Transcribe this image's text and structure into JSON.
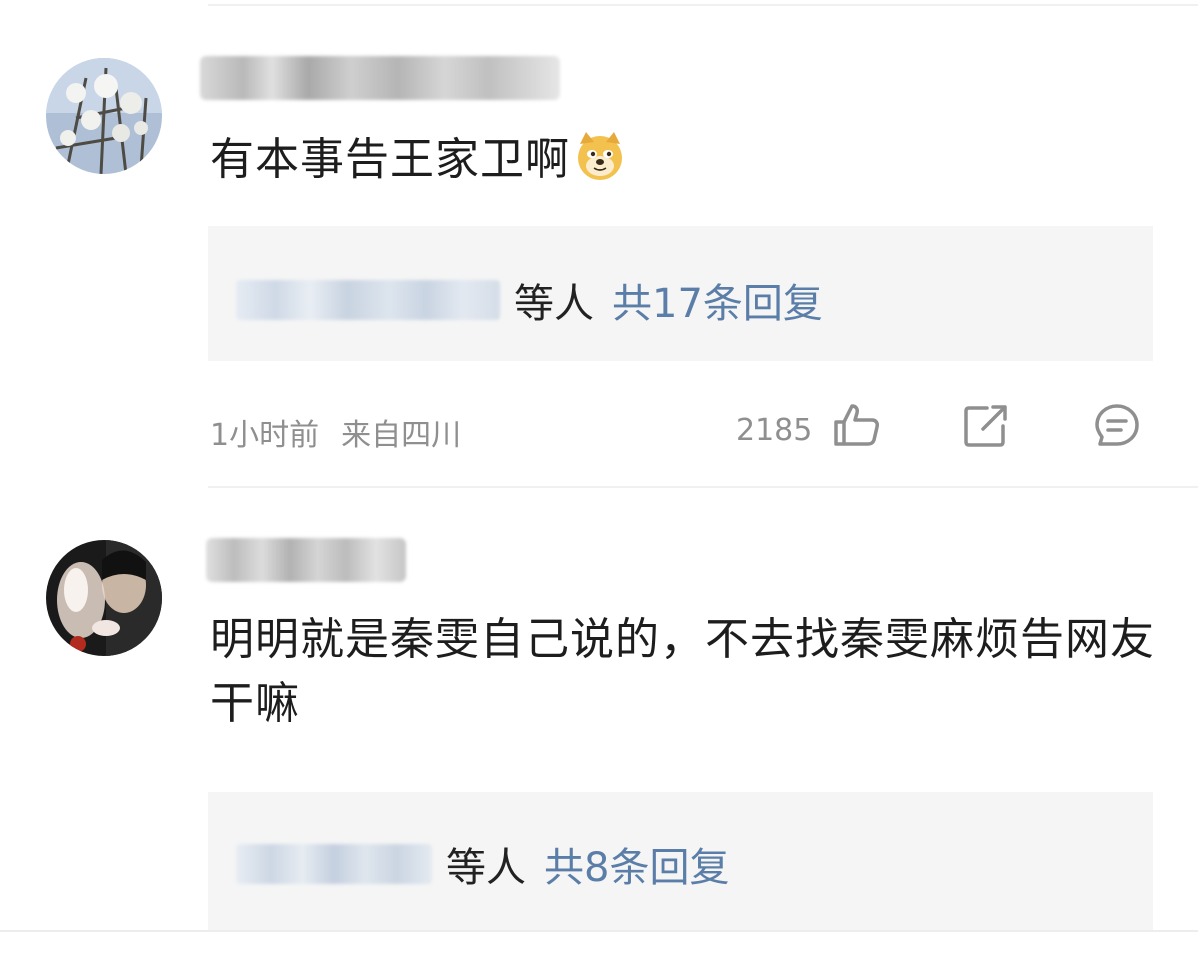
{
  "comments": [
    {
      "text": "有本事告王家卫啊",
      "emoji": "doge-emoji",
      "reply_etc": "等人",
      "reply_count": "共17条回复",
      "time": "1小时前",
      "location": "来自四川",
      "likes": "2185"
    },
    {
      "text": "明明就是秦雯自己说的，不去找秦雯麻烦告网友干嘛",
      "reply_etc": "等人",
      "reply_count": "共8条回复"
    }
  ],
  "icons": {
    "like": "thumbs-up-icon",
    "share": "share-icon",
    "comment": "comment-icon"
  },
  "colors": {
    "link_blue": "#5b7ea8",
    "meta_gray": "#8f8f8f",
    "reply_bg": "#f5f5f5"
  }
}
